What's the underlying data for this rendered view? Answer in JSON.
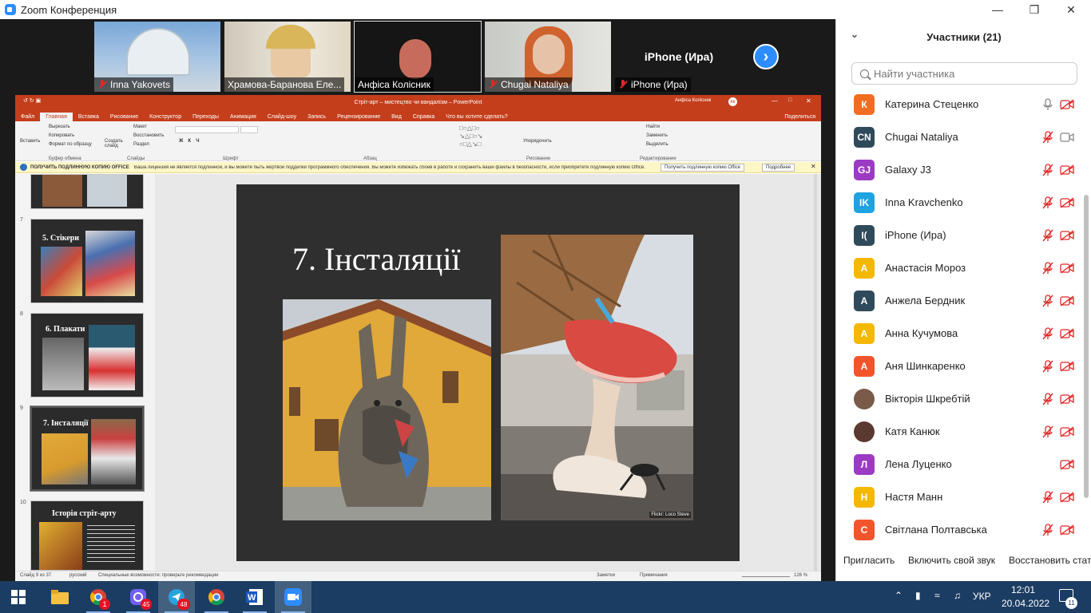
{
  "window": {
    "title": "Zoom Конференция"
  },
  "gallery": {
    "tiles": [
      {
        "name": "Inna Yakovets"
      },
      {
        "name": "Храмова-Баранова Еле..."
      },
      {
        "name": "Анфіса Колісник"
      },
      {
        "name": "Chugai Nataliya"
      },
      {
        "name": "iPhone (Ира)",
        "display": "iPhone (Ира)"
      }
    ]
  },
  "ppt": {
    "title": "Стріт-арт – мистецтво чи вандалізм – PowerPoint",
    "user": "Анфіса Колісник",
    "user_initials": "АК",
    "tabs": [
      "Файл",
      "Главная",
      "Вставка",
      "Рисование",
      "Конструктор",
      "Переходы",
      "Анимация",
      "Слайд-шоу",
      "Запись",
      "Рецензирование",
      "Вид",
      "Справка",
      "Что вы хотите сделать?"
    ],
    "share": "Поделиться",
    "ribbon": {
      "clipboard": "Буфер обмена",
      "slides": "Слайды",
      "font": "Шрифт",
      "paragraph": "Абзац",
      "drawing": "Рисование",
      "editing": "Редактирование",
      "cut": "Вырезать",
      "copy": "Копировать",
      "format": "Формат по образцу",
      "insert": "Вставить",
      "create_slide": "Создать слайд",
      "layout": "Макет",
      "restore": "Восстановить",
      "section": "Раздел",
      "arrange": "Упорядочить",
      "find": "Найти",
      "replace": "Заменить",
      "select": "Выделить"
    },
    "warning": {
      "title": "ПОЛУЧИТЬ ПОДЛИННУЮ КОПИЮ OFFICE",
      "text": "Ваша лицензия не является подлинной, и вы можете быть жертвой подделки программного обеспечения. Вы можете избежать сбоев в работе и сохранить ваши файлы в безопасности, если приобретете подлинную копию Office.",
      "btn1": "Получить подлинную копию Office",
      "btn2": "Подробнее"
    },
    "thumbs": [
      {
        "num": "7",
        "title": "5. Стікери"
      },
      {
        "num": "8",
        "title": "6. Плакати"
      },
      {
        "num": "9",
        "title": "7. Інсталяції"
      },
      {
        "num": "10",
        "title": "Історія стріт-арту"
      }
    ],
    "slide": {
      "title": "7. Інсталяції",
      "caption": "Flickr: Loco Steve"
    },
    "status": {
      "slide": "Слайд 9 из 37",
      "lang": "русский",
      "access": "Специальные возможности: проверьте рекомендации",
      "notes": "Заметки",
      "comments": "Примечания",
      "zoom": "126 %"
    }
  },
  "panel": {
    "title": "Участники (21)",
    "search_placeholder": "Найти участника",
    "participants": [
      {
        "initial": "К",
        "name": "Катерина Стеценко",
        "color": "#f26d21",
        "mic": "on",
        "cam": "off"
      },
      {
        "initial": "CN",
        "name": "Chugai Nataliya",
        "color": "#2f4a5a",
        "mic": "off",
        "cam": "on"
      },
      {
        "initial": "GJ",
        "name": "Galaxy J3",
        "color": "#9b3bc4",
        "mic": "off",
        "cam": "off"
      },
      {
        "initial": "IK",
        "name": "Inna Kravchenko",
        "color": "#1fa3e0",
        "mic": "off",
        "cam": "off"
      },
      {
        "initial": "I(",
        "name": "iPhone (Ира)",
        "color": "#2f4a5a",
        "mic": "off",
        "cam": "off"
      },
      {
        "initial": "А",
        "name": "Анастасія Мороз",
        "color": "#f5b800",
        "mic": "off",
        "cam": "off"
      },
      {
        "initial": "А",
        "name": "Анжела Бердник",
        "color": "#2f4a5a",
        "mic": "off",
        "cam": "off"
      },
      {
        "initial": "А",
        "name": "Анна Кучумова",
        "color": "#f5b800",
        "mic": "off",
        "cam": "off"
      },
      {
        "initial": "А",
        "name": "Аня Шинкаренко",
        "color": "#f2552c",
        "mic": "off",
        "cam": "off"
      },
      {
        "initial": "",
        "name": "Вікторія Шкребтій",
        "color": "#7a5a48",
        "mic": "off",
        "cam": "off"
      },
      {
        "initial": "",
        "name": "Катя Канюк",
        "color": "#5a3a30",
        "mic": "off",
        "cam": "off"
      },
      {
        "initial": "Л",
        "name": "Лена Луценко",
        "color": "#9b3bc4",
        "mic": "none",
        "cam": "off"
      },
      {
        "initial": "Н",
        "name": "Настя Манн",
        "color": "#f5b800",
        "mic": "off",
        "cam": "off"
      },
      {
        "initial": "С",
        "name": "Світлана Полтавська",
        "color": "#f2552c",
        "mic": "off",
        "cam": "off"
      }
    ],
    "footer": {
      "invite": "Пригласить",
      "unmute": "Включить свой звук",
      "restore": "Восстановить стату"
    }
  },
  "taskbar": {
    "lang": "УКР",
    "time": "12:01",
    "date": "20.04.2022",
    "notif": "11",
    "badges": {
      "viber": "45",
      "telegram": "48",
      "chrome": "1"
    }
  }
}
